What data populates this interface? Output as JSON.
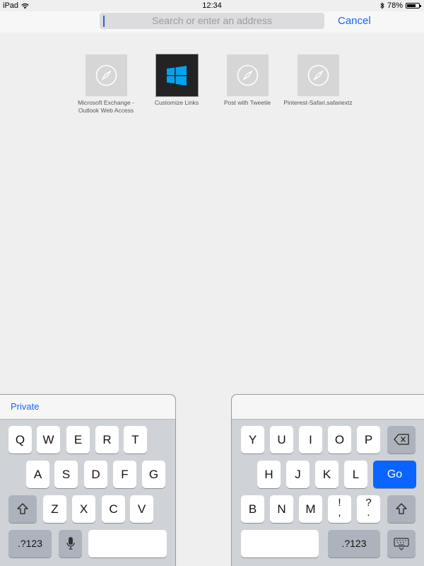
{
  "status": {
    "device": "iPad",
    "time": "12:34",
    "battery": "78%",
    "battery_level": 0.78
  },
  "search": {
    "placeholder": "Search or enter an address"
  },
  "cancel_label": "Cancel",
  "favorites": [
    {
      "label": "Microsoft Exchange - Outlook Web Access",
      "icon": "compass-icon"
    },
    {
      "label": "Customize Links",
      "icon": "windows-logo-icon"
    },
    {
      "label": "Post with Tweetie",
      "icon": "compass-icon"
    },
    {
      "label": "Pinterest-Safari.safariextz",
      "icon": "compass-icon"
    }
  ],
  "keyboard": {
    "private_label": "Private",
    "left_rows": [
      [
        "Q",
        "W",
        "E",
        "R",
        "T"
      ],
      [
        "A",
        "S",
        "D",
        "F",
        "G"
      ],
      [
        "Z",
        "X",
        "C",
        "V"
      ]
    ],
    "right_rows": [
      [
        "Y",
        "U",
        "I",
        "O",
        "P"
      ],
      [
        "H",
        "J",
        "K",
        "L"
      ],
      [
        "B",
        "N",
        "M",
        "!",
        ",",
        "?",
        "."
      ]
    ],
    "numbers_label": ".?123",
    "go_label": "Go"
  }
}
